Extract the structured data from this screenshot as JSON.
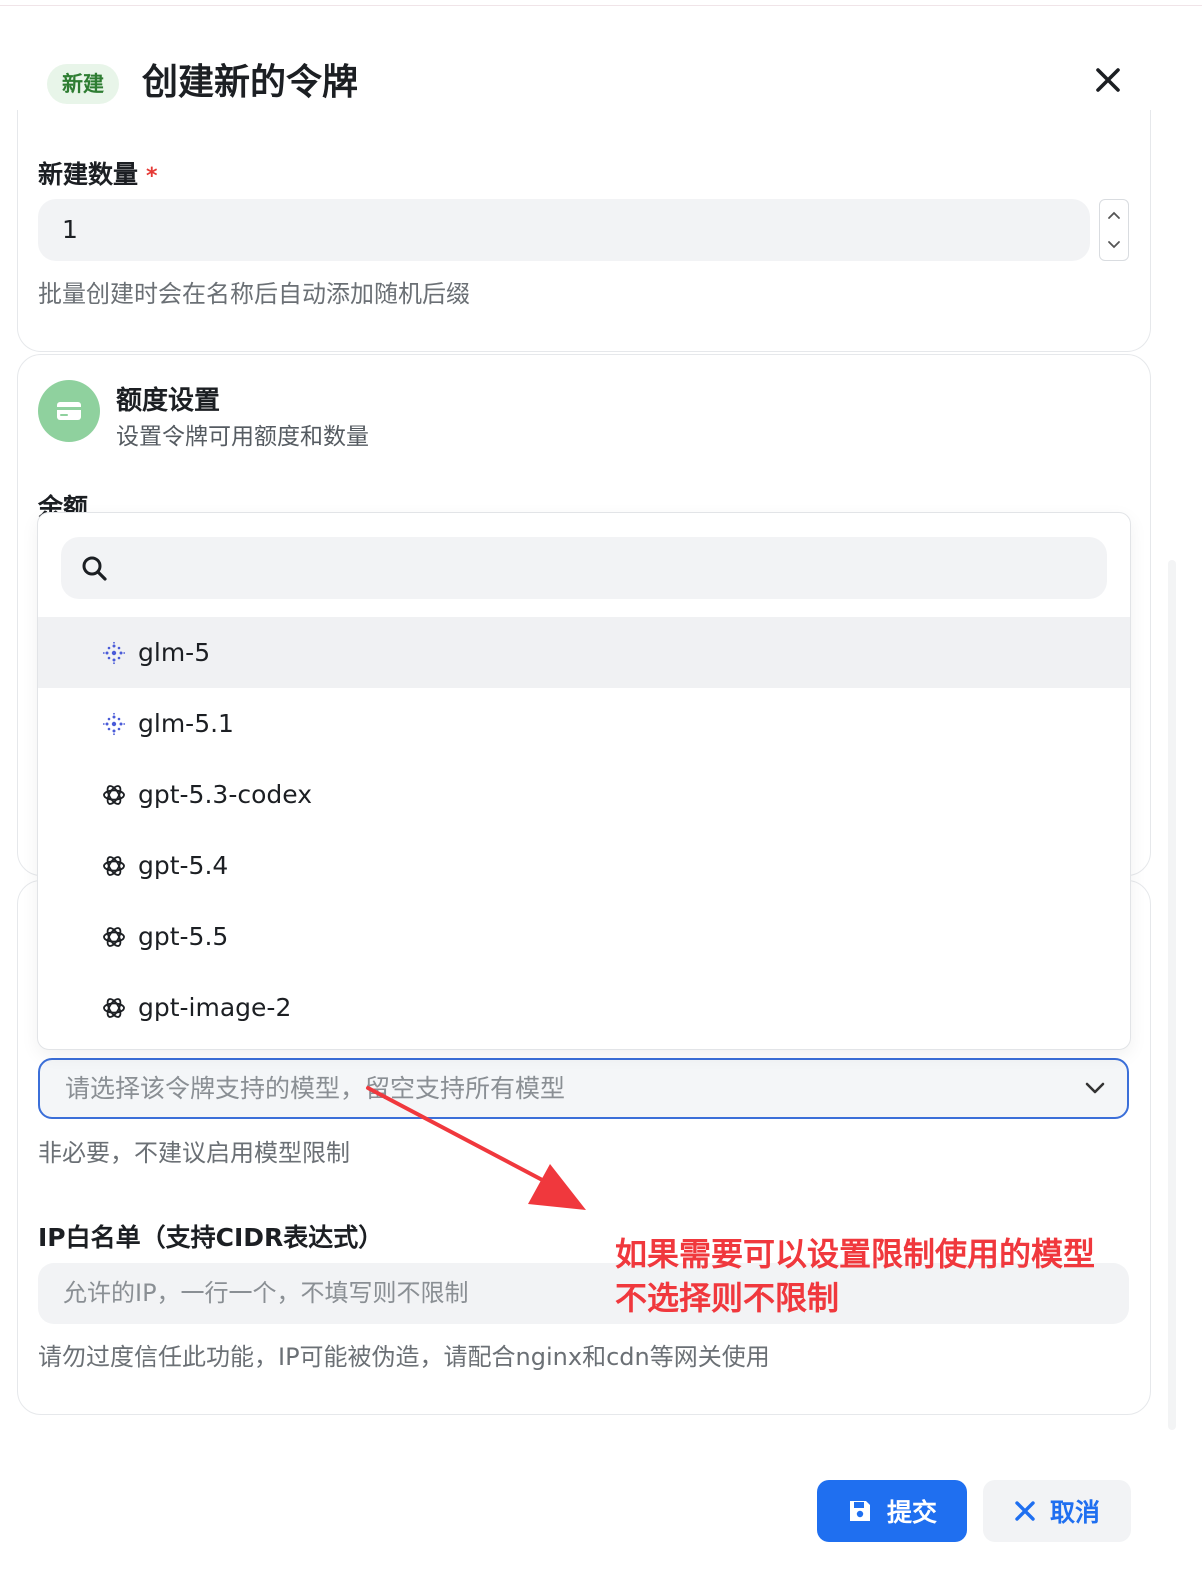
{
  "header": {
    "tag": "新建",
    "title": "创建新的令牌"
  },
  "count_field": {
    "label": "新建数量",
    "required_mark": "*",
    "value": "1",
    "hint": "批量创建时会在名称后自动添加随机后缀"
  },
  "quota_section": {
    "title": "额度设置",
    "subtitle": "设置令牌可用额度和数量",
    "amount_label": "余额"
  },
  "model_dropdown": {
    "search_placeholder": "",
    "items": [
      {
        "label": "glm-5",
        "icon": "zhipu-icon",
        "highlighted": true
      },
      {
        "label": "glm-5.1",
        "icon": "zhipu-icon",
        "highlighted": false
      },
      {
        "label": "gpt-5.3-codex",
        "icon": "openai-icon",
        "highlighted": false
      },
      {
        "label": "gpt-5.4",
        "icon": "openai-icon",
        "highlighted": false
      },
      {
        "label": "gpt-5.5",
        "icon": "openai-icon",
        "highlighted": false
      },
      {
        "label": "gpt-image-2",
        "icon": "openai-icon",
        "highlighted": false
      }
    ]
  },
  "model_select": {
    "placeholder": "请选择该令牌支持的模型，留空支持所有模型",
    "hint": "非必要，不建议启用模型限制"
  },
  "ip_field": {
    "label": "IP白名单（支持CIDR表达式）",
    "placeholder": "允许的IP，一行一个，不填写则不限制",
    "hint": "请勿过度信任此功能，IP可能被伪造，请配合nginx和cdn等网关使用"
  },
  "annotation": {
    "line1": "如果需要可以设置限制使用的模型",
    "line2": "不选择则不限制",
    "color": "#f0383d"
  },
  "footer": {
    "submit_label": "提交",
    "cancel_label": "取消"
  },
  "colors": {
    "primary": "#1f6ff0",
    "tag_bg": "#e8f5e9",
    "tag_fg": "#2e7d32",
    "section_icon_bg": "#8fd19e"
  }
}
